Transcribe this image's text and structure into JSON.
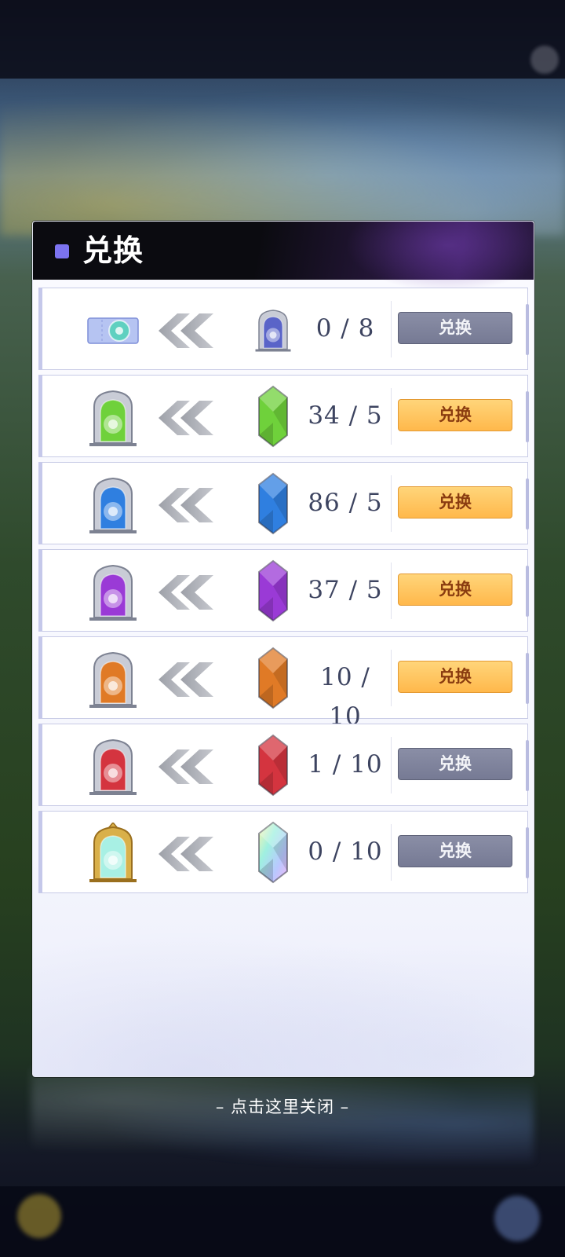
{
  "dialog": {
    "title": "兑换"
  },
  "rows": [
    {
      "source_icon": "ticket-icon",
      "target_icon": "gray-portal-icon",
      "count": "0 / 8",
      "button_label": "兑换",
      "button_state": "disabled",
      "gem_color": "#6b74d8"
    },
    {
      "source_icon": "green-portal-icon",
      "target_icon": "green-crystal-icon",
      "count": "34 / 5",
      "button_label": "兑换",
      "button_state": "active",
      "gem_color": "#6fd13b"
    },
    {
      "source_icon": "blue-portal-icon",
      "target_icon": "blue-crystal-icon",
      "count": "86 / 5",
      "button_label": "兑换",
      "button_state": "active",
      "gem_color": "#2f7fe0"
    },
    {
      "source_icon": "purple-portal-icon",
      "target_icon": "purple-crystal-icon",
      "count": "37 / 5",
      "button_label": "兑换",
      "button_state": "active",
      "gem_color": "#9a3ad6"
    },
    {
      "source_icon": "orange-portal-icon",
      "target_icon": "orange-crystal-icon",
      "count": "10 / 10",
      "button_label": "兑换",
      "button_state": "active",
      "gem_color": "#e07a26"
    },
    {
      "source_icon": "red-portal-icon",
      "target_icon": "red-crystal-icon",
      "count": "1 / 10",
      "button_label": "兑换",
      "button_state": "disabled",
      "gem_color": "#d4343f"
    },
    {
      "source_icon": "gold-portal-icon",
      "target_icon": "rainbow-crystal-icon",
      "count": "0 / 10",
      "button_label": "兑换",
      "button_state": "disabled",
      "gem_color": "#a8f0e4"
    }
  ],
  "footer": {
    "close_hint": "– 点击这里关闭 –"
  },
  "colors": {
    "accent_square": "#7c73f0",
    "button_active": "#ffc062",
    "button_disabled": "#7f839c"
  }
}
